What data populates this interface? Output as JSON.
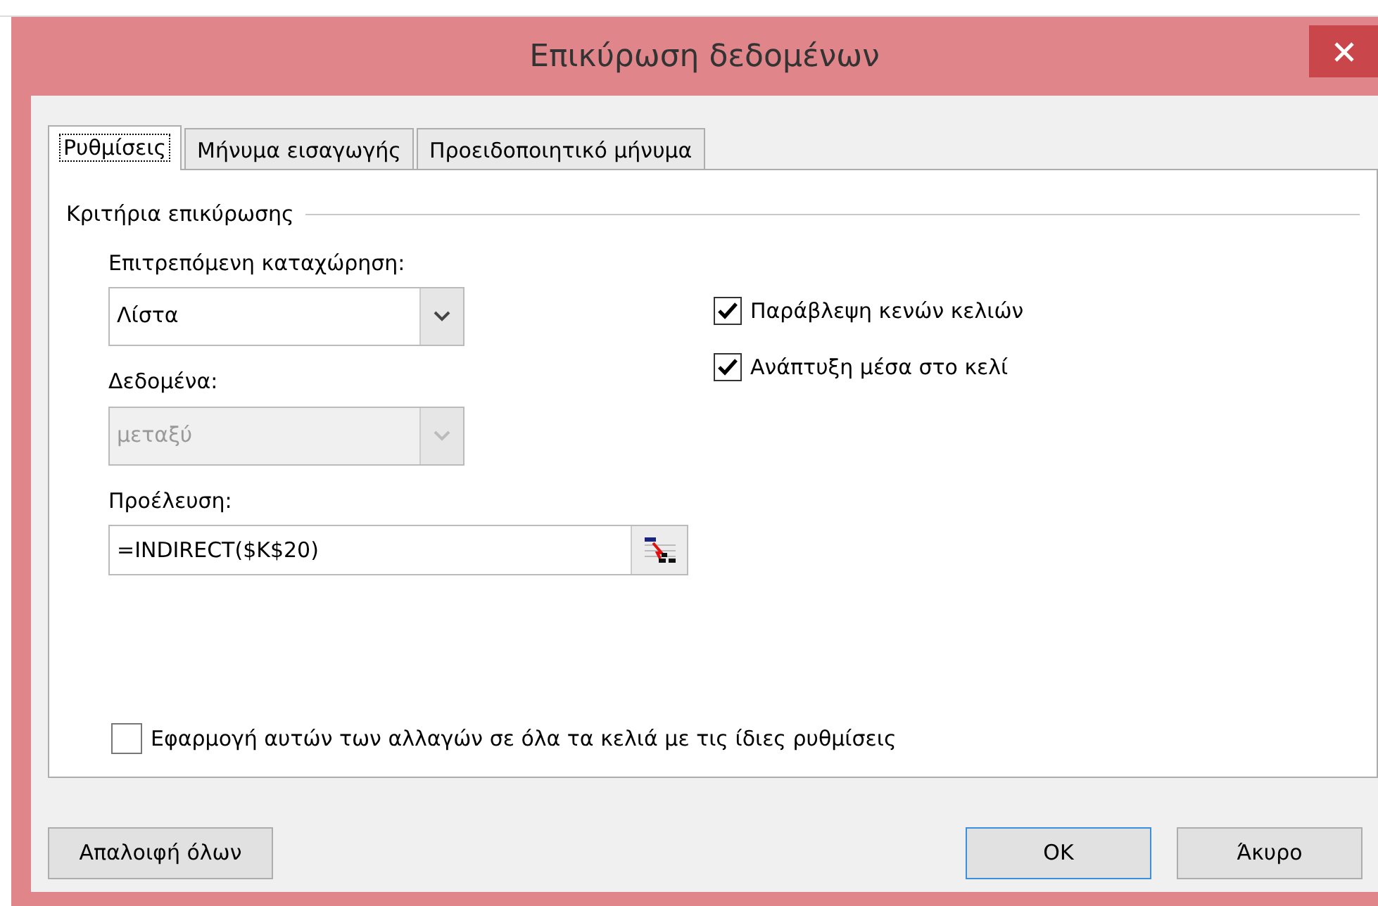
{
  "window": {
    "title": "Επικύρωση δεδομένων"
  },
  "tabs": [
    {
      "label": "Ρυθμίσεις",
      "selected": true
    },
    {
      "label": "Μήνυμα εισαγωγής",
      "selected": false
    },
    {
      "label": "Προειδοποιητικό μήνυμα",
      "selected": false
    }
  ],
  "section": {
    "title": "Κριτήρια επικύρωσης"
  },
  "fields": [
    {
      "kind": "dropdown",
      "label": "Επιτρεπόμενη καταχώρηση:",
      "value": "Λίστα",
      "disabled": false
    },
    {
      "kind": "dropdown",
      "label": "Δεδομένα:",
      "value": "μεταξύ",
      "disabled": true
    },
    {
      "kind": "range",
      "label": "Προέλευση:",
      "value": "=INDIRECT($K$20)"
    }
  ],
  "options": [
    {
      "label": "Παράβλεψη κενών κελιών",
      "checked": true
    },
    {
      "label": "Ανάπτυξη μέσα στο κελί",
      "checked": true
    }
  ],
  "apply_all": {
    "label": "Εφαρμογή αυτών των αλλαγών σε όλα τα κελιά με τις ίδιες ρυθμίσεις",
    "checked": false
  },
  "buttons": [
    {
      "label": "Απαλοιφή όλων",
      "default": false
    },
    {
      "label": "OK",
      "default": true
    },
    {
      "label": "Άκυρο",
      "default": false
    }
  ]
}
